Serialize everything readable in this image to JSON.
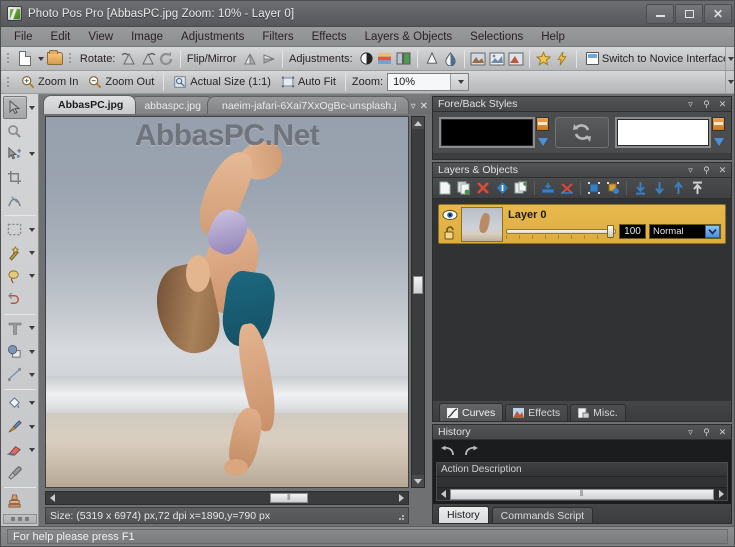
{
  "window": {
    "title": "Photo Pos Pro [AbbasPC.jpg Zoom: 10% - Layer 0]",
    "app_icon": "photo-pos-pro-icon",
    "minimize": "–",
    "maximize": "□",
    "close": "✕"
  },
  "menu": {
    "items": [
      "File",
      "Edit",
      "View",
      "Image",
      "Adjustments",
      "Filters",
      "Effects",
      "Layers & Objects",
      "Selections",
      "Help"
    ]
  },
  "toolbar_main": {
    "new_label": "new-document",
    "open_label": "open-file",
    "rotate_label": "Rotate:",
    "flip_label": "Flip/Mirror",
    "adjustments_label": "Adjustments:",
    "novice_label": "Switch to Novice Interface",
    "icons": [
      "rotate-left-icon",
      "rotate-right-icon",
      "rotate-free-icon",
      "flip-vertical-icon",
      "flip-horizontal-icon",
      "brightness-contrast-icon",
      "levels-icon",
      "color-balance-icon",
      "hue-icon",
      "saturation-icon",
      "image-effects-icon",
      "image-filter-icon",
      "image-enhance-icon",
      "favorites-icon",
      "quick-fix-icon"
    ]
  },
  "toolbar_zoom": {
    "zoom_in": "Zoom In",
    "zoom_out": "Zoom Out",
    "actual_size": "Actual Size (1:1)",
    "auto_fit": "Auto Fit",
    "zoom_label": "Zoom:",
    "zoom_value": "10%"
  },
  "tools": [
    {
      "name": "pointer-tool",
      "glyph": "arrow",
      "has_caret": true,
      "active": true
    },
    {
      "name": "zoom-tool",
      "glyph": "magnifier",
      "has_caret": false,
      "active": false
    },
    {
      "name": "move-tool",
      "glyph": "move-arrow",
      "has_caret": true,
      "active": false
    },
    {
      "name": "crop-tool",
      "glyph": "crop",
      "has_caret": false,
      "active": false
    },
    {
      "name": "path-tool",
      "glyph": "bezier",
      "has_caret": false,
      "active": false
    },
    {
      "name": "rectangle-select-tool",
      "glyph": "marquee",
      "has_caret": true,
      "active": false
    },
    {
      "name": "magic-wand-tool",
      "glyph": "wand",
      "has_caret": true,
      "active": false
    },
    {
      "name": "lasso-tool",
      "glyph": "lasso",
      "has_caret": true,
      "active": false
    },
    {
      "name": "selection-edit-tool",
      "glyph": "select-edit",
      "has_caret": false,
      "active": false
    },
    {
      "name": "text-tool",
      "glyph": "T",
      "has_caret": true,
      "active": false
    },
    {
      "name": "shape-tool",
      "glyph": "shapes",
      "has_caret": true,
      "active": false
    },
    {
      "name": "line-tool",
      "glyph": "line",
      "has_caret": true,
      "active": false
    },
    {
      "name": "paint-bucket-tool",
      "glyph": "bucket",
      "has_caret": true,
      "active": false
    },
    {
      "name": "brush-tool",
      "glyph": "brush",
      "has_caret": true,
      "active": false
    },
    {
      "name": "eraser-tool",
      "glyph": "eraser",
      "has_caret": true,
      "active": false
    },
    {
      "name": "eyedropper-tool",
      "glyph": "eyedropper",
      "has_caret": false,
      "active": false
    },
    {
      "name": "clone-stamp-tool",
      "glyph": "stamp",
      "has_caret": false,
      "active": false
    }
  ],
  "document_tabs": {
    "tabs": [
      {
        "label": "AbbasPC.jpg",
        "active": true
      },
      {
        "label": "abbaspc.jpg",
        "active": false
      },
      {
        "label": "naeim-jafari-6Xai7XxOgBc-unsplash.j",
        "active": false
      }
    ],
    "dropdown_icon": "chevron-down-icon",
    "close_icon": "close-icon"
  },
  "canvas": {
    "watermark": "AbbasPC.Net",
    "status": "Size: (5319 x 6974) px,72 dpi   x=1890,y=790 px",
    "scroll_grip": "⦀"
  },
  "fore_back_panel": {
    "title": "Fore/Back Styles",
    "foreground_color": "#000000",
    "background_color": "#ffffff",
    "swap_icon": "swap-colors-icon",
    "collapse_icon": "chevron-down-icon",
    "pin_icon": "pin-icon",
    "close_icon": "close-icon"
  },
  "layers_panel": {
    "title": "Layers & Objects",
    "collapse_icon": "chevron-down-icon",
    "pin_icon": "pin-icon",
    "close_icon": "close-icon",
    "tool_icons": [
      "new-layer-icon",
      "duplicate-layer-icon",
      "delete-layer-icon",
      "layer-properties-icon",
      "new-group-icon",
      "merge-down-icon",
      "flatten-icon",
      "group-layers-icon",
      "ungroup-layers-icon",
      "send-to-bottom-icon",
      "move-down-icon",
      "move-up-icon",
      "send-to-top-icon"
    ],
    "layer": {
      "name": "Layer 0",
      "opacity": "100",
      "blend_mode": "Normal",
      "visible_icon": "eye-icon",
      "lock_icon": "unlock-icon",
      "thumbnail": "layer-thumbnail"
    },
    "tabs": [
      {
        "label": "Curves",
        "icon": "curves-icon",
        "active": true
      },
      {
        "label": "Effects",
        "icon": "effects-icon",
        "active": false
      },
      {
        "label": "Misc.",
        "icon": "misc-icon",
        "active": false
      }
    ]
  },
  "history_panel": {
    "title": "History",
    "collapse_icon": "chevron-down-icon",
    "pin_icon": "pin-icon",
    "close_icon": "close-icon",
    "undo_icon": "undo-icon",
    "redo_icon": "redo-icon",
    "column_header": "Action Description",
    "tabs": [
      {
        "label": "History",
        "active": true
      },
      {
        "label": "Commands Script",
        "active": false
      }
    ]
  },
  "statusbar": {
    "text": "For help please press F1"
  },
  "colors": {
    "accent_layer": "#e0b044",
    "panel_bg": "#3d3e40",
    "chrome": "#8d8e90",
    "blue_icon": "#4a90d9",
    "red_icon": "#d94a3a"
  }
}
